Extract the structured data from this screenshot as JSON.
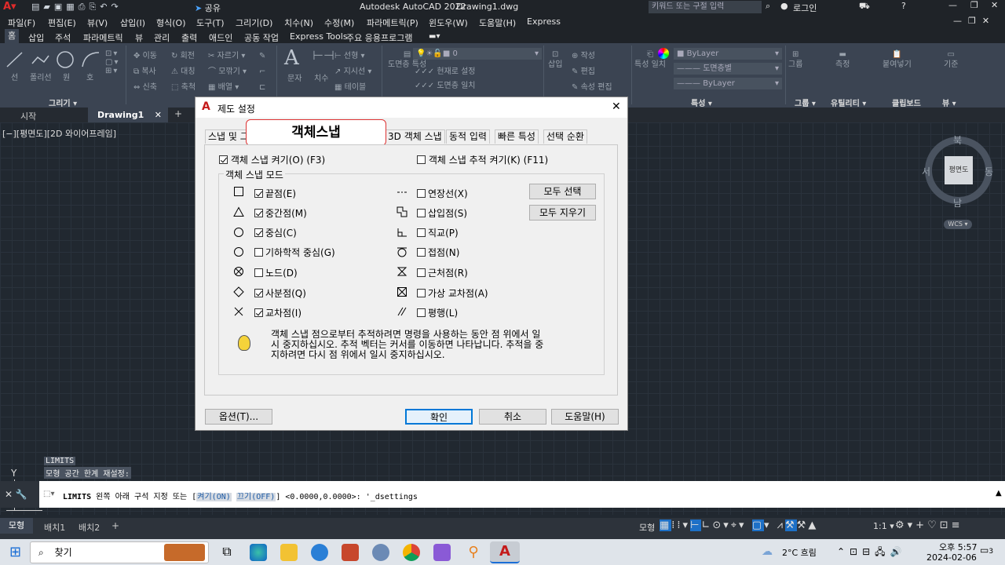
{
  "window": {
    "app_title": "Autodesk AutoCAD 2022",
    "file_title": "Drawing1.dwg",
    "share_label": "공유",
    "search_placeholder": "키워드 또는 구절 입력",
    "login_label": "로그인"
  },
  "menu": [
    "파일(F)",
    "편집(E)",
    "뷰(V)",
    "삽입(I)",
    "형식(O)",
    "도구(T)",
    "그리기(D)",
    "치수(N)",
    "수정(M)",
    "파라메트릭(P)",
    "윈도우(W)",
    "도움말(H)",
    "Express"
  ],
  "ribbon_tabs": [
    "홈",
    "삽입",
    "주석",
    "파라메트릭",
    "뷰",
    "관리",
    "출력",
    "애드인",
    "공동 작업",
    "Express Tools",
    "주요 응용프로그램"
  ],
  "ribbon": {
    "draw_tools": [
      "선",
      "폴리선",
      "원",
      "호"
    ],
    "modify_tools": [
      "이동",
      "회전",
      "자르기",
      "복사",
      "대칭",
      "모깎기",
      "신축",
      "축척",
      "배열"
    ],
    "annot": [
      "문자",
      "치수"
    ],
    "annot_sub": [
      "선형",
      "지시선",
      "테이블"
    ],
    "layer_tools": [
      "도면층 특성",
      "현재로 설정",
      "도면층 일치"
    ],
    "layer_value": "0",
    "block_tools": [
      "삽입",
      "작성",
      "편집",
      "속성 편집"
    ],
    "props_tools": [
      "특성 일치"
    ],
    "bylayer_color": "ByLayer",
    "linetype": "도면층별",
    "lineweight": "ByLayer",
    "groups": [
      "그리기",
      "특성",
      "그룹",
      "유틸리티",
      "클립보드",
      "뷰"
    ],
    "group_labels": [
      "그룹",
      "측정",
      "붙여넣기",
      "기준"
    ]
  },
  "file_tabs": {
    "start": "시작",
    "drawing": "Drawing1"
  },
  "viewport_label": "[−][평면도][2D 와이어프레임]",
  "viewcube": {
    "north": "북",
    "south": "남",
    "east": "동",
    "west": "서",
    "face": "평면도",
    "wcs": "WCS"
  },
  "dialog": {
    "title": "제도 설정",
    "tabs": [
      "스냅 및 그리드",
      "객체스냅",
      "3D 객체 스냅",
      "동적 입력",
      "빠른 특성",
      "선택 순환"
    ],
    "active_tab_overlay": "객체스냅",
    "osnap_on": "객체 스냅 켜기(O) (F3)",
    "osnap_track": "객체 스냅 추적 켜기(K) (F11)",
    "group_title": "객체 스냅 모드",
    "left_modes": [
      {
        "label": "끝점(E)",
        "on": true
      },
      {
        "label": "중간점(M)",
        "on": true
      },
      {
        "label": "중심(C)",
        "on": true
      },
      {
        "label": "기하학적 중심(G)",
        "on": false
      },
      {
        "label": "노드(D)",
        "on": false
      },
      {
        "label": "사분점(Q)",
        "on": true
      },
      {
        "label": "교차점(I)",
        "on": true
      }
    ],
    "right_modes": [
      {
        "label": "연장선(X)",
        "on": false
      },
      {
        "label": "삽입점(S)",
        "on": false
      },
      {
        "label": "직교(P)",
        "on": false
      },
      {
        "label": "접점(N)",
        "on": false
      },
      {
        "label": "근처점(R)",
        "on": false
      },
      {
        "label": "가상 교차점(A)",
        "on": false
      },
      {
        "label": "평행(L)",
        "on": false
      }
    ],
    "select_all": "모두 선택",
    "clear_all": "모두 지우기",
    "tip_line1": "객체 스냅 점으로부터 추적하려면 명령을 사용하는 동안 점 위에서 일",
    "tip_line2": "시 중지하십시오. 추적 벡터는 커서를 이동하면 나타납니다. 추적을 중",
    "tip_line3": "지하려면 다시 점 위에서 일시 중지하십시오.",
    "options": "옵션(T)...",
    "ok": "확인",
    "cancel": "취소",
    "help": "도움말(H)"
  },
  "command": {
    "hist1": "LIMITS",
    "hist2": "모형 공간 한계 재설정:",
    "cmd_name": "LIMITS",
    "cmd_text": "왼쪽 아래 구석 지정 또는 [",
    "opt_on": "켜기(ON)",
    "opt_off": "끄기(OFF)",
    "cmd_rest": "] <0.0000,0.0000>: '_dsettings"
  },
  "layout_tabs": [
    "모형",
    "배치1",
    "배치2"
  ],
  "status": {
    "model": "모형",
    "scale": "1:1"
  },
  "taskbar": {
    "search": "찾기",
    "weather": "2°C 흐림",
    "time": "오후 5:57",
    "date": "2024-02-06",
    "notif_count": "3"
  }
}
